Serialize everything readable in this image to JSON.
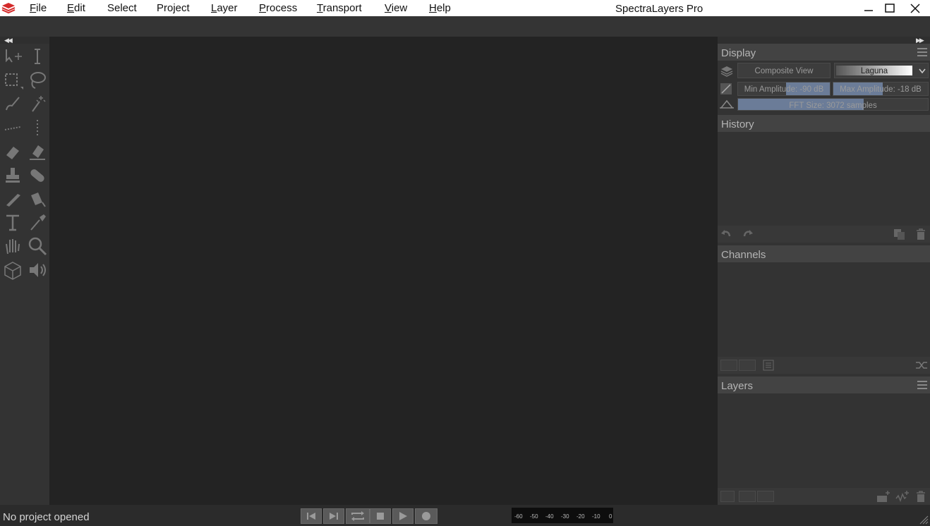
{
  "app": {
    "title": "SpectraLayers Pro"
  },
  "menu": [
    {
      "mnemonic": "F",
      "rest": "ile"
    },
    {
      "mnemonic": "E",
      "rest": "dit"
    },
    {
      "mnemonic": "",
      "rest": "Select"
    },
    {
      "mnemonic": "",
      "rest": "Project"
    },
    {
      "mnemonic": "L",
      "rest": "ayer"
    },
    {
      "mnemonic": "P",
      "rest": "rocess"
    },
    {
      "mnemonic": "T",
      "rest": "ransport"
    },
    {
      "mnemonic": "V",
      "rest": "iew"
    },
    {
      "mnemonic": "H",
      "rest": "elp"
    }
  ],
  "window_buttons": [
    "minimize-icon",
    "maximize-icon",
    "close-icon"
  ],
  "display": {
    "title": "Display",
    "view_button": "Composite View",
    "colormap": "Laguna",
    "min_amplitude": "Min Amplitude: -90 dB",
    "max_amplitude": "Max Amplitude: -18 dB",
    "min_amplitude_fill": 0.48,
    "max_amplitude_fill": 0.52,
    "fft_size": "FFT Size: 3072 samples",
    "fft_fill": 0.66,
    "accent": "#6b7c98"
  },
  "history": {
    "title": "History"
  },
  "channels": {
    "title": "Channels"
  },
  "layers": {
    "title": "Layers"
  },
  "tools": [
    "move-tool-icon",
    "time-selection-icon",
    "rectangle-select-icon",
    "lasso-icon",
    "brush-select-icon",
    "magic-wand-icon",
    "frequency-select-icon",
    "harmonics-icon",
    "eraser-icon",
    "amplitude-eraser-icon",
    "clone-stamp-icon",
    "heal-icon",
    "pencil-icon",
    "fill-icon",
    "text-icon",
    "eyedropper-icon",
    "hand-icon",
    "zoom-icon",
    "3d-view-icon",
    "speaker-icon"
  ],
  "status": {
    "text": "No project opened"
  },
  "transport": [
    "skip-back-icon",
    "skip-forward-icon",
    "loop-icon",
    "stop-icon",
    "play-icon",
    "record-icon"
  ],
  "meter": {
    "ticks": [
      "-60",
      "-50",
      "-40",
      "-30",
      "-20",
      "-10",
      "0"
    ]
  }
}
